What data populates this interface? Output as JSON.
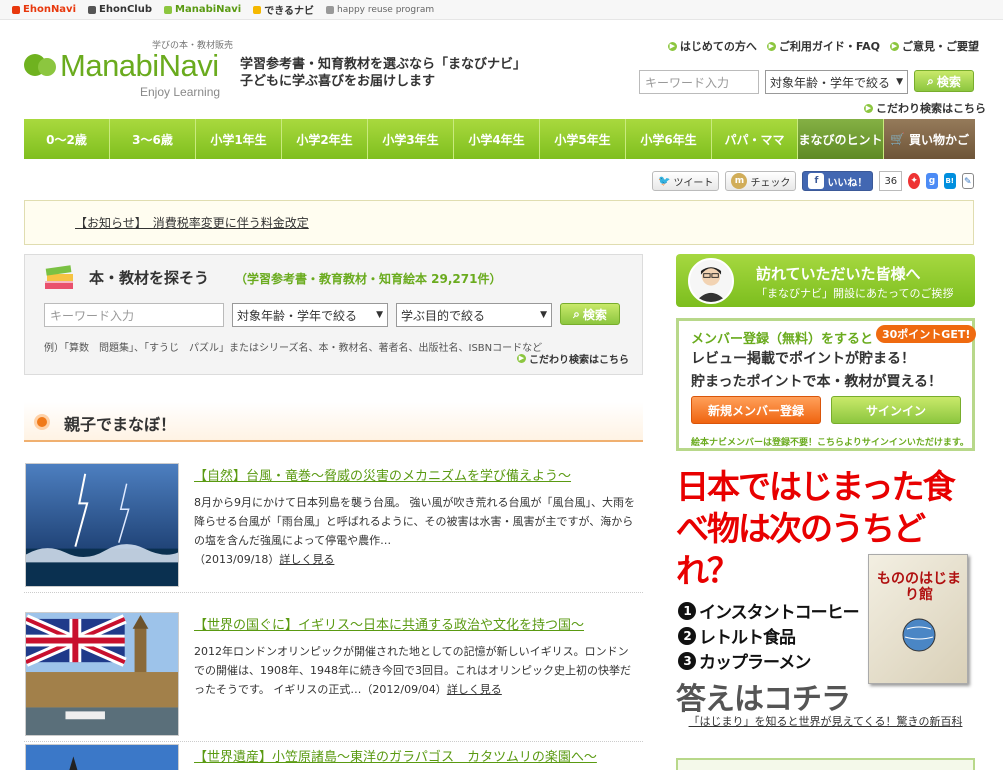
{
  "sitebar": {
    "links": [
      {
        "label": "EhonNavi",
        "color": "#e8380d"
      },
      {
        "label": "EhonClub",
        "color": "#333333"
      },
      {
        "label": "ManabiNavi",
        "color": "#5a9a12"
      },
      {
        "label": "できるナビ",
        "color": "#333333"
      },
      {
        "label": "happy reuse program",
        "color": "#666666"
      }
    ]
  },
  "header": {
    "logo_tag": "学びの本・教材販売",
    "logo_name": "ManabiNavi",
    "logo_sub": "Enjoy Learning",
    "tagline_1": "学習参考書・知育教材を選ぶなら「まなびナビ」",
    "tagline_2": "子どもに学ぶ喜びをお届けします",
    "top_links": [
      "はじめての方へ",
      "ご利用ガイド・FAQ",
      "ご意見・ご要望"
    ],
    "search_placeholder": "キーワード入力",
    "age_select": "対象年齢・学年で絞る",
    "search_button": "検索",
    "advanced_link": "こだわり検索はこちら"
  },
  "nav": {
    "items": [
      "0～2歳",
      "3～6歳",
      "小学1年生",
      "小学2年生",
      "小学3年生",
      "小学4年生",
      "小学5年生",
      "小学6年生",
      "パパ・ママ",
      "まなびのヒント",
      "買い物かご"
    ]
  },
  "social": {
    "tweet": "ツイート",
    "check": "チェック",
    "like": "いいね！",
    "like_count": "36"
  },
  "notice": {
    "text": "【お知らせ】　消費税率変更に伴う料金改定"
  },
  "search_panel": {
    "title": "本・教材を探そう",
    "count": "（学習参考書・教育教材・知育絵本 29,271件）",
    "placeholder": "キーワード入力",
    "age_select": "対象年齢・学年で絞る",
    "purpose_select": "学ぶ目的で絞る",
    "button": "検索",
    "example": "例）「算数　問題集」、「すうじ　パズル」またはシリーズ名、本・教材名、著者名、出版社名、ISBNコードなど",
    "advanced_link": "こだわり検索はこちら"
  },
  "section": {
    "title": "親子でまなぼ！"
  },
  "articles": [
    {
      "title": "【自然】台風・竜巻～脅威の災害のメカニズムを学び備えよう～",
      "body": "8月から9月にかけて日本列島を襲う台風。 強い風が吹き荒れる台風が「風台風」、大雨を降らせる台風が「雨台風」と呼ばれるように、その被害は水害・風害が主ですが、海からの塩を含んだ強風によって停電や農作…",
      "date": "（2013/09/18）",
      "more": "詳しく見る"
    },
    {
      "title": "【世界の国ぐに】イギリス～日本に共通する政治や文化を持つ国～",
      "body": "2012年ロンドンオリンピックが開催された地としての記憶が新しいイギリス。ロンドンでの開催は、1908年、1948年に続き今回で3回目。これはオリンピック史上初の快挙だったそうです。 イギリスの正式…",
      "date": "（2012/09/04）",
      "more": "詳しく見る"
    },
    {
      "title": "【世界遺産】小笠原諸島～東洋のガラパゴス　カタツムリの楽園へ～",
      "body": "",
      "date": "",
      "more": ""
    }
  ],
  "greeting": {
    "line1": "訪れていただいた皆様へ",
    "line2": "「まなびナビ」開設にあたってのご挨拶"
  },
  "member": {
    "line1": "メンバー登録（無料）をすると",
    "badge": "30ポイントGET!",
    "line2": "レビュー掲載でポイントが貯まる！",
    "line3": "貯まったポイントで本・教材が買える！",
    "register": "新規メンバー登録",
    "signin": "サインイン",
    "note": "絵本ナビメンバーは登録不要！こちらよりサインインいただけます。"
  },
  "ad": {
    "question": "日本ではじまった食べ物は次のうちどれ？",
    "options": [
      "インスタントコーヒー",
      "レトルト食品",
      "カップラーメン"
    ],
    "option_numbers": [
      "1",
      "2",
      "3"
    ],
    "answer": "答えはコチラ",
    "book_title": "もののはじまり館",
    "caption": "「はじまり」を知ると世界が見えてくる！驚きの新百科"
  },
  "colors": {
    "brand_green": "#8cc63f",
    "accent_orange": "#ef6410",
    "ad_red": "#e80000"
  }
}
